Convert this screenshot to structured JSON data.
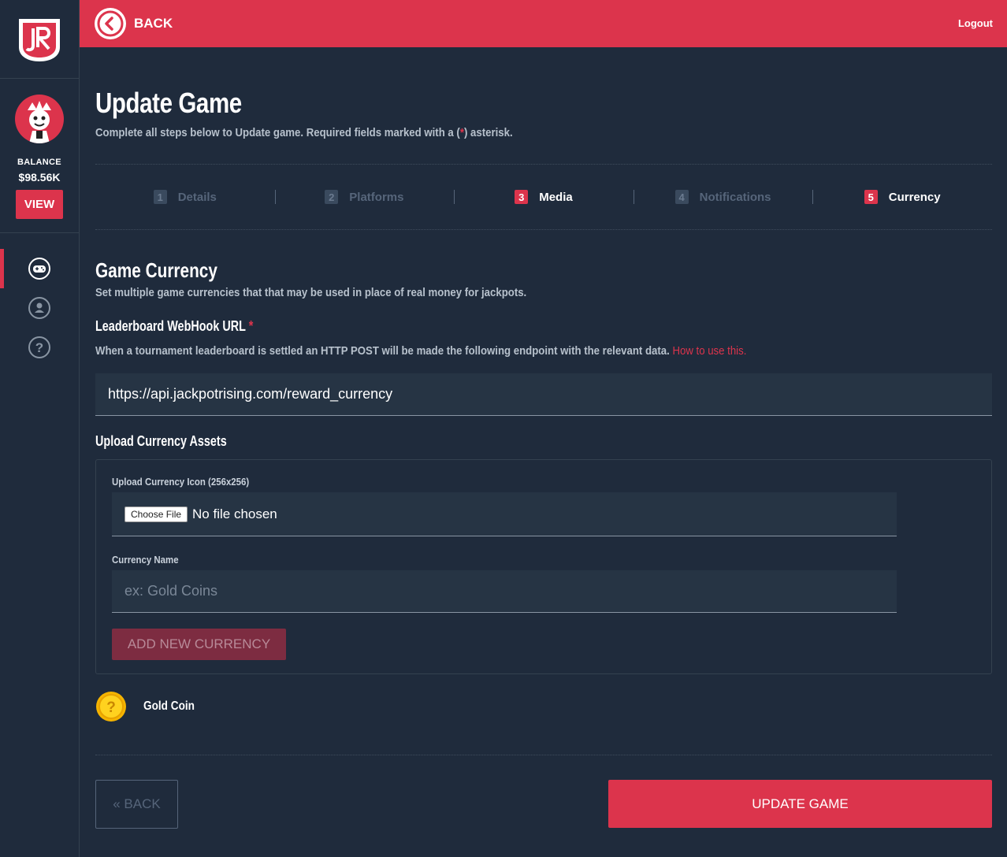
{
  "topbar": {
    "back_label": "BACK",
    "logout_label": "Logout"
  },
  "sidebar": {
    "balance_label": "BALANCE",
    "balance_value": "$98.56K",
    "view_label": "VIEW"
  },
  "page": {
    "title": "Update Game",
    "subtitle_before": "Complete all steps below to Update game. Required fields marked with a (",
    "subtitle_asterisk": "*",
    "subtitle_after": ") asterisk."
  },
  "steps": [
    {
      "num": "1",
      "label": "Details"
    },
    {
      "num": "2",
      "label": "Platforms"
    },
    {
      "num": "3",
      "label": "Media"
    },
    {
      "num": "4",
      "label": "Notifications"
    },
    {
      "num": "5",
      "label": "Currency"
    }
  ],
  "currency": {
    "title": "Game Currency",
    "desc": "Set multiple game currencies that that may be used in place of real money for jackpots.",
    "webhook_title": "Leaderboard WebHook URL",
    "required_mark": "*",
    "webhook_desc": "When a tournament leaderboard is settled an HTTP POST will be made the following endpoint with the relevant data.",
    "how_to_link": "How to use this.",
    "webhook_value": "https://api.jackpotrising.com/reward_currency",
    "upload_title": "Upload Currency Assets",
    "icon_label": "Upload Currency Icon (256x256)",
    "choose_file": "Choose File",
    "no_file": "No file chosen",
    "name_label": "Currency Name",
    "name_placeholder": "ex: Gold Coins",
    "add_label": "ADD NEW CURRENCY",
    "existing_name": "Gold Coin"
  },
  "footer": {
    "back_label": "« BACK",
    "update_label": "UPDATE GAME"
  },
  "colors": {
    "accent": "#dc344c",
    "background": "#1f2b3c"
  }
}
